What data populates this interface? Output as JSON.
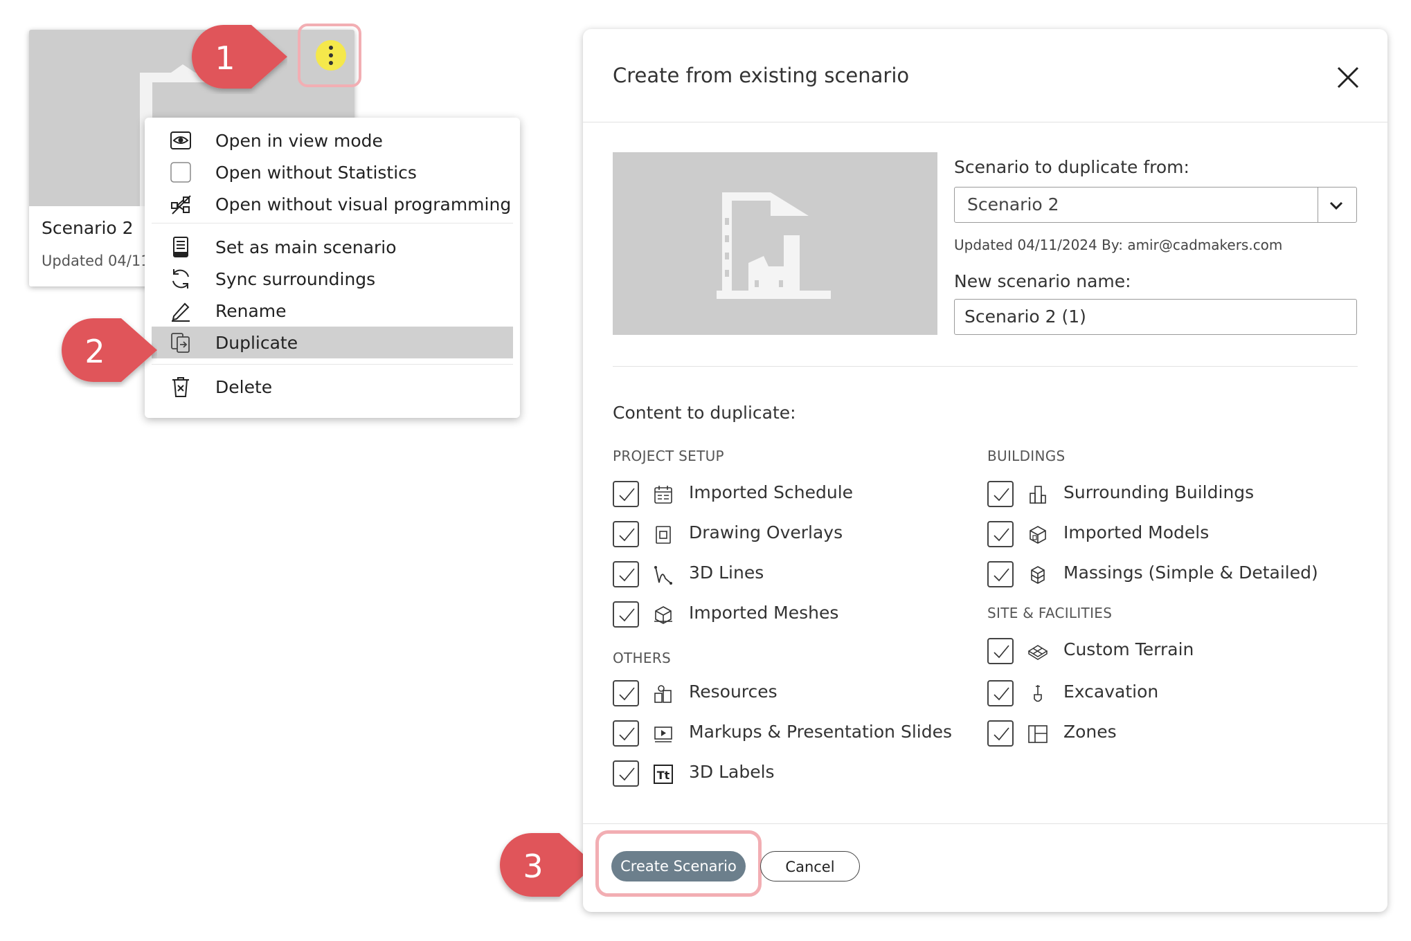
{
  "card": {
    "title": "Scenario 2",
    "updated": "Updated 04/11/"
  },
  "menu": {
    "items": [
      {
        "label": "Open in view mode",
        "icon": "eye-icon"
      },
      {
        "label": "Open without Statistics",
        "icon": "blank-icon"
      },
      {
        "label": "Open without visual programming",
        "icon": "no-programming-icon"
      },
      {
        "label": "Set as main scenario",
        "icon": "main-scenario-icon"
      },
      {
        "label": "Sync surroundings",
        "icon": "sync-icon"
      },
      {
        "label": "Rename",
        "icon": "pencil-icon"
      },
      {
        "label": "Duplicate",
        "icon": "duplicate-icon",
        "active": true
      },
      {
        "label": "Delete",
        "icon": "trash-icon"
      }
    ]
  },
  "callouts": [
    "1",
    "2",
    "3"
  ],
  "dialog": {
    "title": "Create from existing scenario",
    "source_label": "Scenario to duplicate from:",
    "source_value": "Scenario 2",
    "updated_line": "Updated 04/11/2024 By: amir@cadmakers.com",
    "name_label": "New scenario name:",
    "name_value": "Scenario 2 (1)",
    "content_label": "Content to duplicate:",
    "sections": {
      "project_setup": {
        "title": "PROJECT SETUP",
        "items": [
          {
            "label": "Imported Schedule",
            "checked": true,
            "icon": "schedule-icon"
          },
          {
            "label": "Drawing Overlays",
            "checked": true,
            "icon": "overlay-icon"
          },
          {
            "label": "3D Lines",
            "checked": true,
            "icon": "lines-icon"
          },
          {
            "label": "Imported Meshes",
            "checked": true,
            "icon": "mesh-icon"
          }
        ]
      },
      "others": {
        "title": "OTHERS",
        "items": [
          {
            "label": "Resources",
            "checked": true,
            "icon": "resources-icon"
          },
          {
            "label": "Markups & Presentation Slides",
            "checked": true,
            "icon": "presentation-icon"
          },
          {
            "label": "3D Labels",
            "checked": true,
            "icon": "text-label-icon"
          }
        ]
      },
      "buildings": {
        "title": "BUILDINGS",
        "items": [
          {
            "label": "Surrounding Buildings",
            "checked": true,
            "icon": "buildings-icon"
          },
          {
            "label": "Imported Models",
            "checked": true,
            "icon": "models-icon"
          },
          {
            "label": "Massings (Simple & Detailed)",
            "checked": true,
            "icon": "massing-icon"
          }
        ]
      },
      "site": {
        "title": "SITE & FACILITIES",
        "items": [
          {
            "label": "Custom Terrain",
            "checked": true,
            "icon": "terrain-icon"
          },
          {
            "label": "Excavation",
            "checked": true,
            "icon": "excavation-icon"
          },
          {
            "label": "Zones",
            "checked": true,
            "icon": "zones-icon"
          }
        ]
      }
    },
    "create_label": "Create Scenario",
    "cancel_label": "Cancel"
  },
  "colors": {
    "callout": "#e0555a",
    "highlight": "#f2aeb3",
    "kebab": "#f5e84b",
    "primary_button": "#6c7f8c"
  }
}
